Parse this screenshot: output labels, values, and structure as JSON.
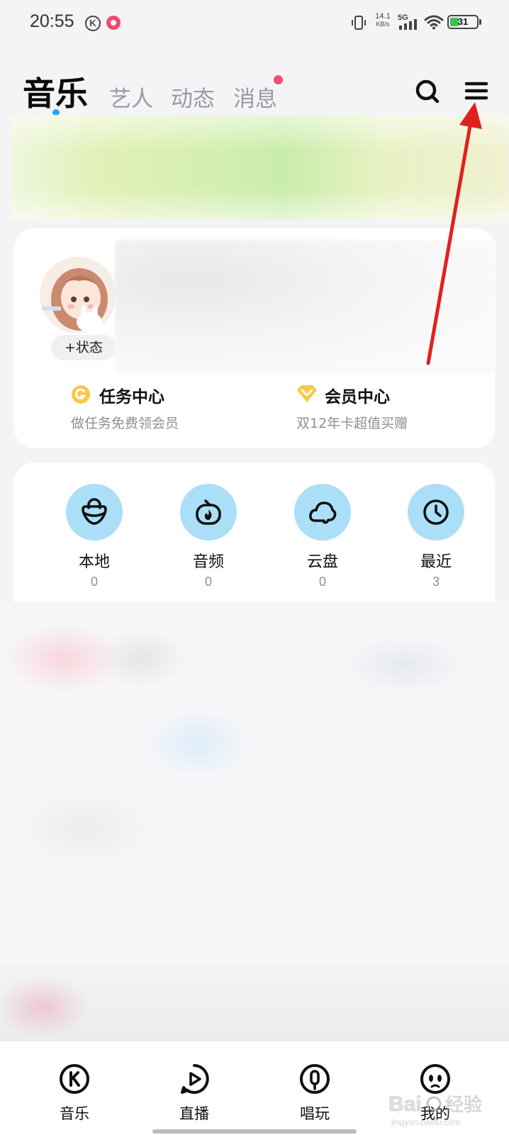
{
  "status_bar": {
    "time": "20:55",
    "net_speed_value": "14.1",
    "net_speed_unit": "KB/s",
    "network": "5G",
    "battery": "31"
  },
  "tabs": {
    "active": "音乐",
    "items": [
      "艺人",
      "动态",
      "消息"
    ]
  },
  "profile": {
    "status_button": "+状态",
    "task_center": {
      "title": "任务中心",
      "subtitle": "做任务免费领会员"
    },
    "vip_center": {
      "title": "会员中心",
      "subtitle": "双12年卡超值买赠"
    }
  },
  "quick_access": [
    {
      "label": "本地",
      "count": "0",
      "icon": "lock-bag-icon"
    },
    {
      "label": "音频",
      "count": "0",
      "icon": "radio-flame-icon"
    },
    {
      "label": "云盘",
      "count": "0",
      "icon": "cloud-icon"
    },
    {
      "label": "最近",
      "count": "3",
      "icon": "clock-icon"
    }
  ],
  "bottom_nav": [
    {
      "label": "音乐",
      "icon": "k-music-icon"
    },
    {
      "label": "直播",
      "icon": "live-play-icon"
    },
    {
      "label": "唱玩",
      "icon": "microphone-icon"
    },
    {
      "label": "我的",
      "icon": "profile-face-icon"
    }
  ],
  "colors": {
    "accent_blue": "#1aa8ee",
    "badge_red": "#f24e6a",
    "quick_circle": "#abdff7",
    "annotation_arrow": "#e02020",
    "battery_green": "#3cc453"
  }
}
